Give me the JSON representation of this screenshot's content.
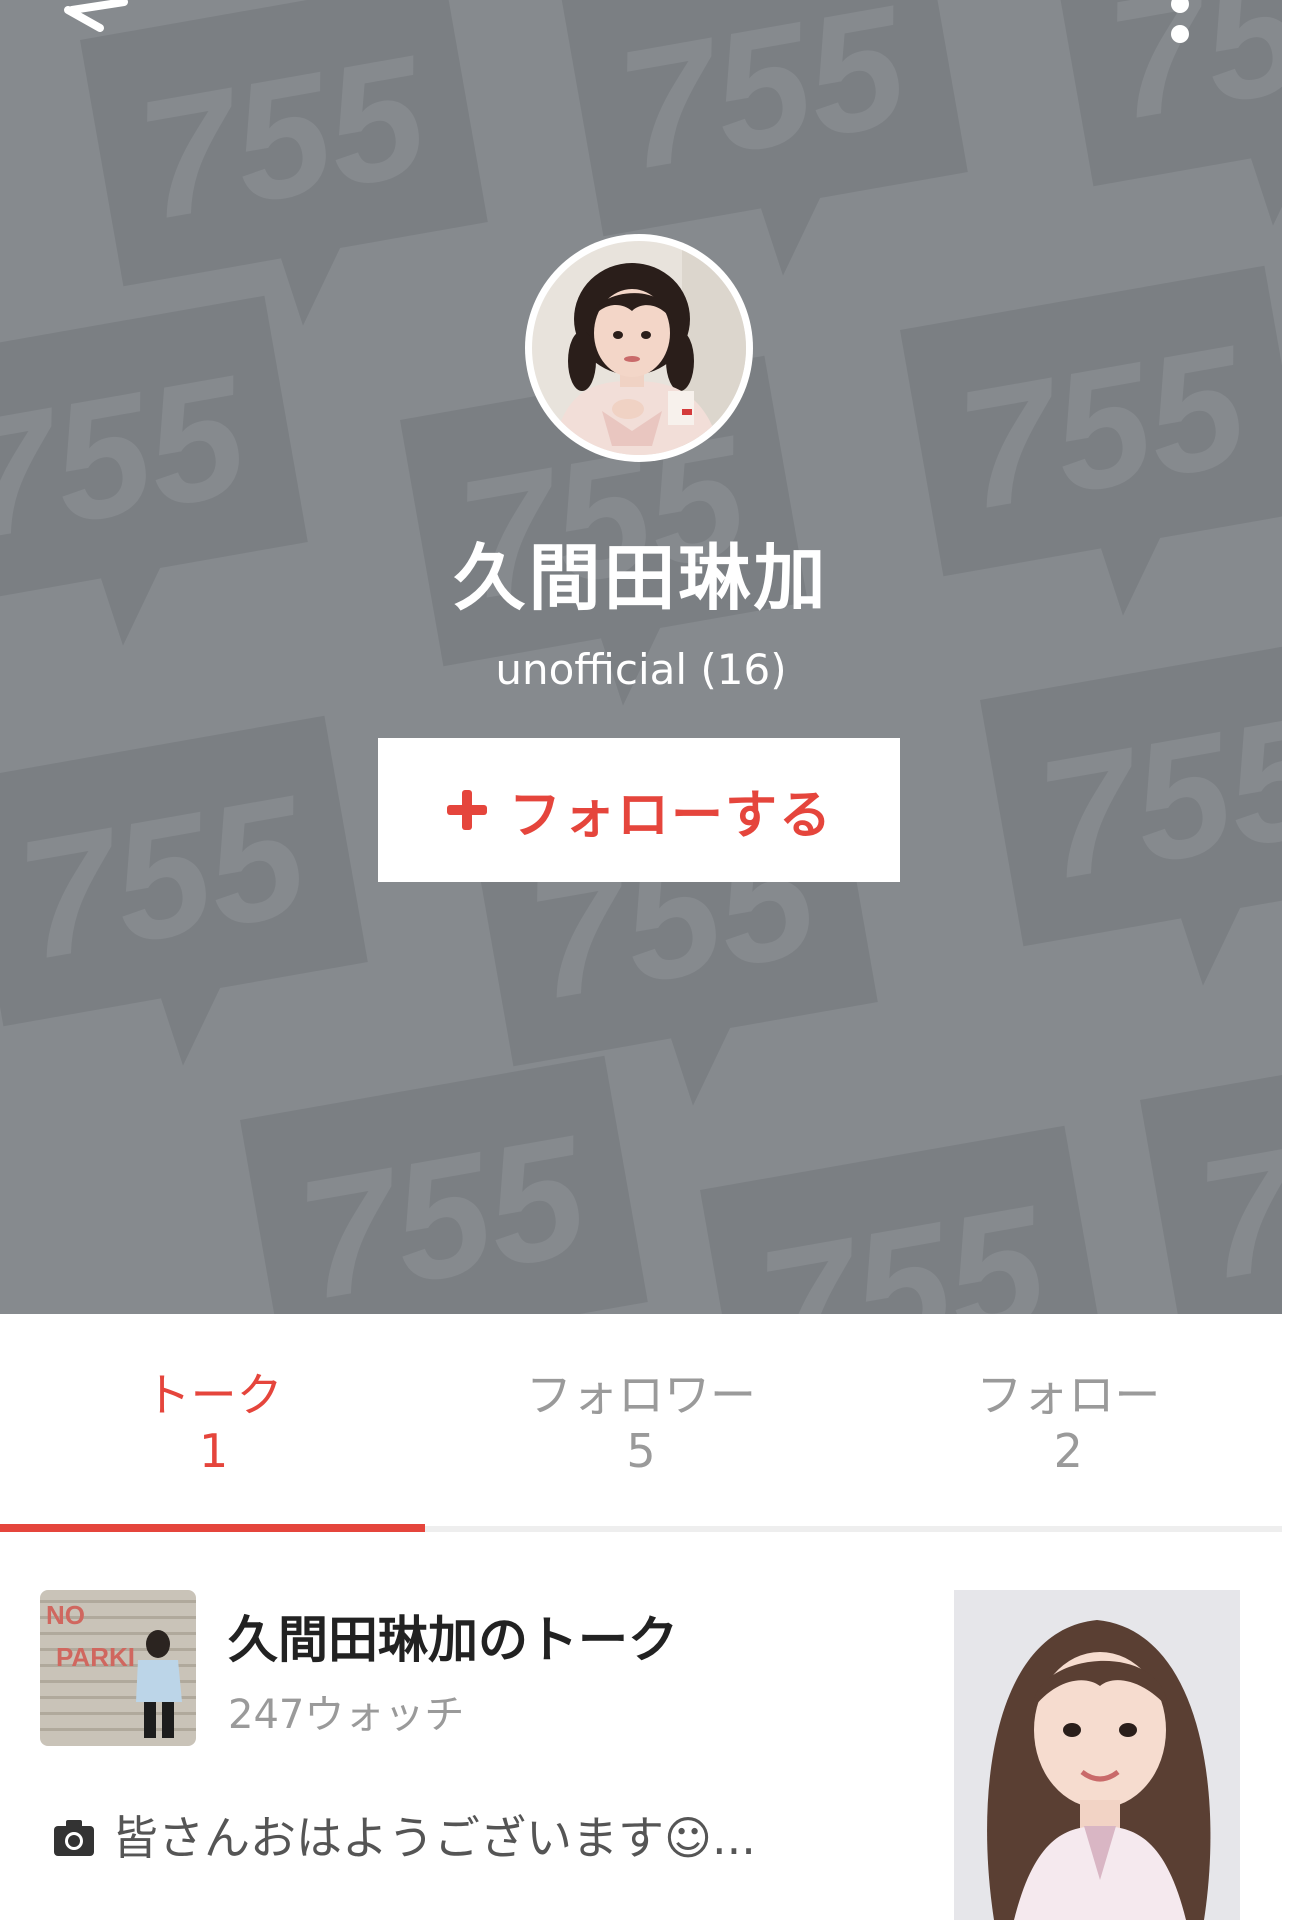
{
  "header": {
    "pattern_text": "755",
    "background_color": "#868a8e",
    "pattern_color": "#7b7f83",
    "back_icon": "back-arrow-icon",
    "menu_icon": "more-vertical-icon"
  },
  "profile": {
    "name": "久間田琳加",
    "subtitle": "unofficial (16)",
    "avatar_icon": "profile-photo"
  },
  "follow_button": {
    "label": "フォローする",
    "icon": "plus-icon",
    "color": "#e5453c"
  },
  "tabs": [
    {
      "label": "トーク",
      "count": "1",
      "active": true
    },
    {
      "label": "フォロワー",
      "count": "5",
      "active": false
    },
    {
      "label": "フォロー",
      "count": "2",
      "active": false
    }
  ],
  "talk": {
    "title": "久間田琳加のトーク",
    "watch": "247ウォッチ",
    "preview": "皆さんおはようございます☺︎...",
    "preview_icon": "camera-icon",
    "thumb_text_1": "NO",
    "thumb_text_2": "PARKI"
  }
}
